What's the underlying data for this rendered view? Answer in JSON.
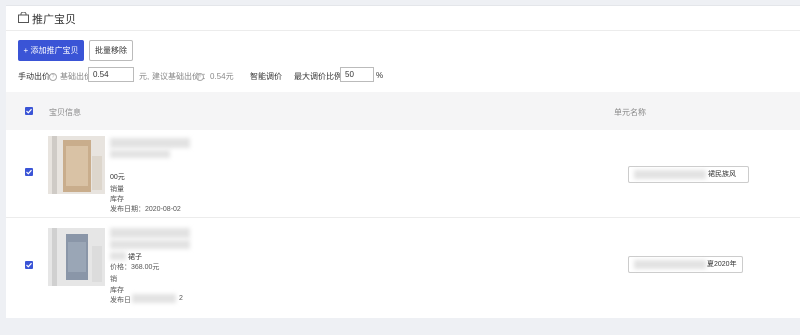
{
  "header": {
    "title": "推广宝贝"
  },
  "toolbar": {
    "add_label": "+ 添加推广宝贝",
    "batch_remove_label": "批量移除"
  },
  "bid": {
    "manual_label": "手动出价",
    "base_label": "基础出价",
    "base_value": "0.54",
    "unit_yuan": "元,",
    "suggest_label": "建议基础出价",
    "suggest_value": "：0.54元",
    "smart_label": "智能调价",
    "max_ratio_label": "最大调价比例",
    "max_ratio_value": "50",
    "percent": "%"
  },
  "table": {
    "col_item": "宝贝信息",
    "col_unit": "单元名称",
    "rows": [
      {
        "price": "00元",
        "sales_label": "销量",
        "stock_label": "库存",
        "date_label": "发布日期：2020-08-02",
        "unit_name": "裙民族风"
      },
      {
        "title_part": "裙子",
        "price": "价格：368.00元",
        "sales_label": "销",
        "stock_label": "库存",
        "date_label": "发布日",
        "date_tail": "2",
        "unit_name": "夏2020年"
      }
    ]
  },
  "colors": {
    "accent": "#3a54d6"
  }
}
